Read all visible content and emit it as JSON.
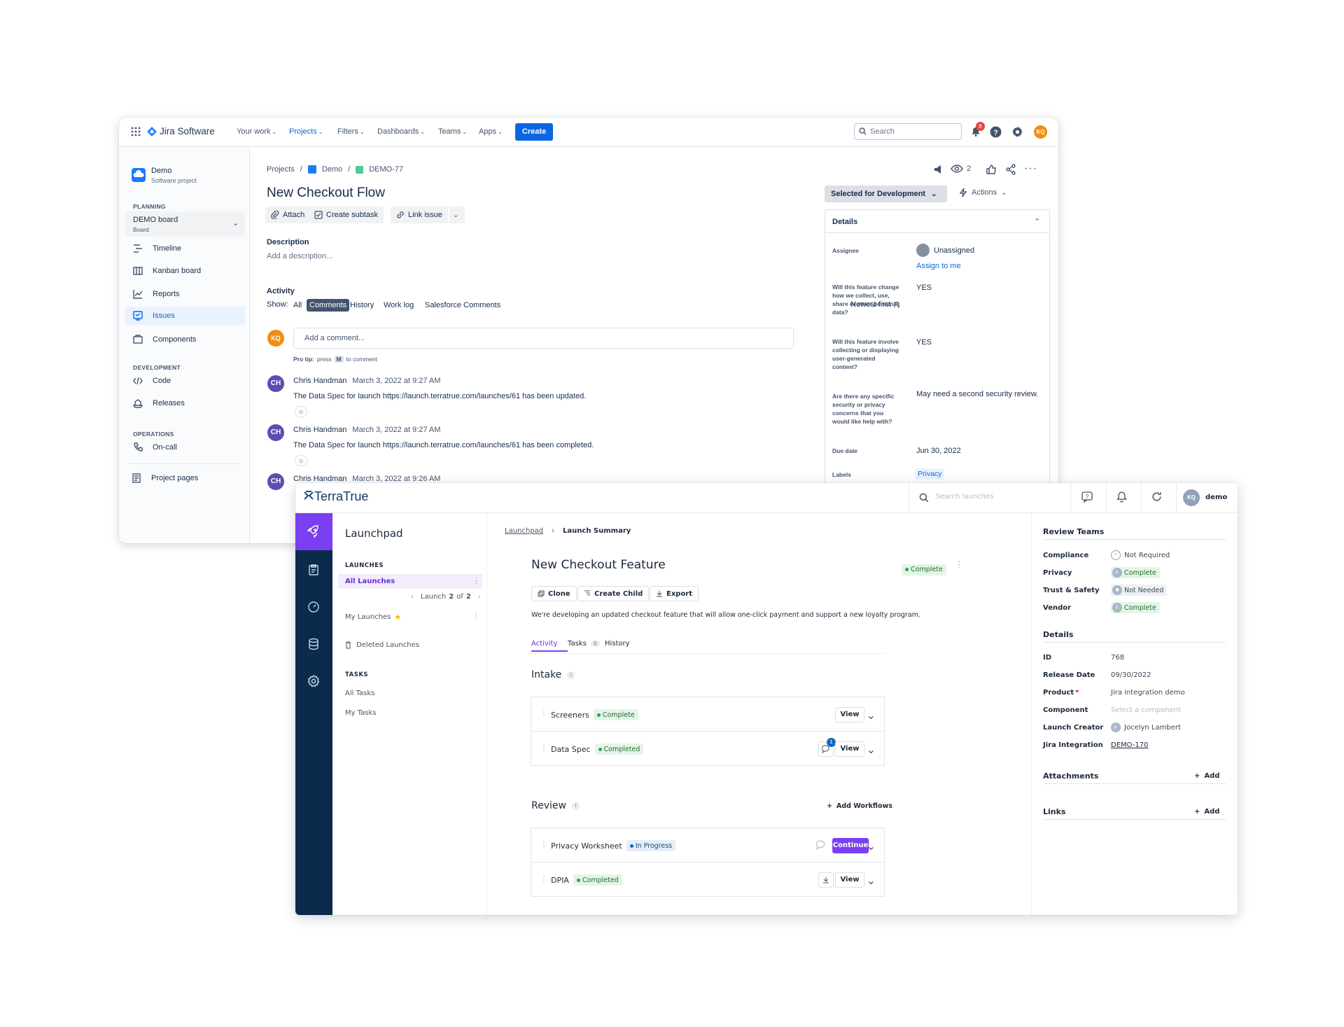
{
  "jira": {
    "brand": "Jira Software",
    "nav": [
      "Your work",
      "Projects",
      "Filters",
      "Dashboards",
      "Teams",
      "Apps"
    ],
    "create": "Create",
    "search_placeholder": "Search",
    "notif_count": "8",
    "user_initials": "KQ",
    "project": {
      "name": "Demo",
      "type": "Software project"
    },
    "sidebar": {
      "planning": "PLANNING",
      "board": {
        "name": "DEMO board",
        "sub": "Board"
      },
      "planning_items": [
        "Timeline",
        "Kanban board",
        "Reports"
      ],
      "issues": "Issues",
      "components": "Components",
      "development": "DEVELOPMENT",
      "dev_items": [
        "Code",
        "Releases"
      ],
      "operations": "OPERATIONS",
      "oncall": "On-call",
      "project_pages": "Project pages"
    },
    "breadcrumb": [
      "Projects",
      "Demo",
      "DEMO-77"
    ],
    "watchers": "2",
    "title": "New Checkout Flow",
    "actions": [
      "Attach",
      "Create subtask",
      "Link issue"
    ],
    "description_label": "Description",
    "description_placeholder": "Add a description...",
    "activity_label": "Activity",
    "show_label": "Show:",
    "activity_tabs": [
      "All",
      "Comments",
      "History",
      "Work log",
      "Salesforce Comments"
    ],
    "sort": "Newest first",
    "comment_placeholder": "Add a comment...",
    "protip": {
      "prefix": "Pro tip:",
      "press": "press",
      "key": "M",
      "suffix": "to comment"
    },
    "comments": [
      {
        "initials": "CH",
        "author": "Chris Handman",
        "date": "March 3, 2022 at 9:27 AM",
        "body": "The Data Spec for launch https://launch.terratrue.com/launches/61 has been updated."
      },
      {
        "initials": "CH",
        "author": "Chris Handman",
        "date": "March 3, 2022 at 9:27 AM",
        "body": "The Data Spec for launch https://launch.terratrue.com/launches/61 has been completed."
      },
      {
        "initials": "CH",
        "author": "Chris Handman",
        "date": "March 3, 2022 at 9:26 AM",
        "body": ""
      }
    ],
    "status": "Selected for Development",
    "actions_menu": "Actions",
    "details": {
      "header": "Details",
      "assignee_label": "Assignee",
      "assignee": "Unassigned",
      "assign_to_me": "Assign to me",
      "q1": "Will this feature change how we collect, use, share or store personal data?",
      "a1": "YES",
      "q2": "Will this feature involve collecting or displaying user-generated content?",
      "a2": "YES",
      "q3": "Are there any specific security or privacy concerns that you would like help with?",
      "a3": "May need a second security review.",
      "due_label": "Due date",
      "due": "Jun 30, 2022",
      "labels_label": "Labels",
      "label": "Privacy"
    }
  },
  "terratrue": {
    "brand": "TerraTrue",
    "search_placeholder": "Search launches",
    "user_initials": "KQ",
    "user": "demo",
    "left": {
      "title": "Launchpad",
      "launches_header": "LAUNCHES",
      "all_launches": "All Launches",
      "pager": {
        "prefix": "Launch",
        "current": "2",
        "of": "of",
        "total": "2"
      },
      "my_launches": "My Launches",
      "deleted": "Deleted Launches",
      "tasks_header": "TASKS",
      "all_tasks": "All Tasks",
      "my_tasks": "My Tasks"
    },
    "breadcrumb": [
      "Launchpad",
      "Launch Summary"
    ],
    "title": "New Checkout Feature",
    "status": "Complete",
    "buttons": [
      "Clone",
      "Create Child",
      "Export"
    ],
    "description": "We're developing an updated checkout feature that will allow one-click payment and support a new loyalty program.",
    "tabs": {
      "activity": "Activity",
      "tasks": "Tasks",
      "tasks_count": "0",
      "history": "History"
    },
    "intake": {
      "title": "Intake",
      "items": [
        {
          "name": "Screeners",
          "status": "Complete",
          "action": "View"
        },
        {
          "name": "Data Spec",
          "status": "Completed",
          "action": "View",
          "comment_count": "1"
        }
      ]
    },
    "review": {
      "title": "Review",
      "add": "Add Workflows",
      "items": [
        {
          "name": "Privacy Worksheet",
          "status": "In Progress",
          "action": "Continue"
        },
        {
          "name": "DPIA",
          "status": "Completed",
          "action": "View"
        }
      ]
    },
    "right": {
      "review_teams": "Review Teams",
      "teams": [
        {
          "label": "Compliance",
          "value": "Not Required"
        },
        {
          "label": "Privacy",
          "value": "Complete",
          "initials": "JL"
        },
        {
          "label": "Trust & Safety",
          "value": "Not Needed"
        },
        {
          "label": "Vendor",
          "value": "Complete",
          "initials": "JL"
        }
      ],
      "details": "Details",
      "fields": [
        {
          "label": "ID",
          "value": "768"
        },
        {
          "label": "Release Date",
          "value": "09/30/2022"
        },
        {
          "label": "Product",
          "req": "*",
          "value": "Jira integration demo"
        },
        {
          "label": "Component",
          "value": "Select a component"
        },
        {
          "label": "Launch Creator",
          "value": "Jocelyn Lambert",
          "initials": "JL"
        },
        {
          "label": "Jira Integration",
          "value": "DEMO-170"
        }
      ],
      "attachments": "Attachments",
      "links": "Links",
      "add": "Add"
    },
    "colors": {
      "rail": "#0b2b4c",
      "accent": "#7b3ff2",
      "jira_blue": "#0c66e4"
    }
  }
}
